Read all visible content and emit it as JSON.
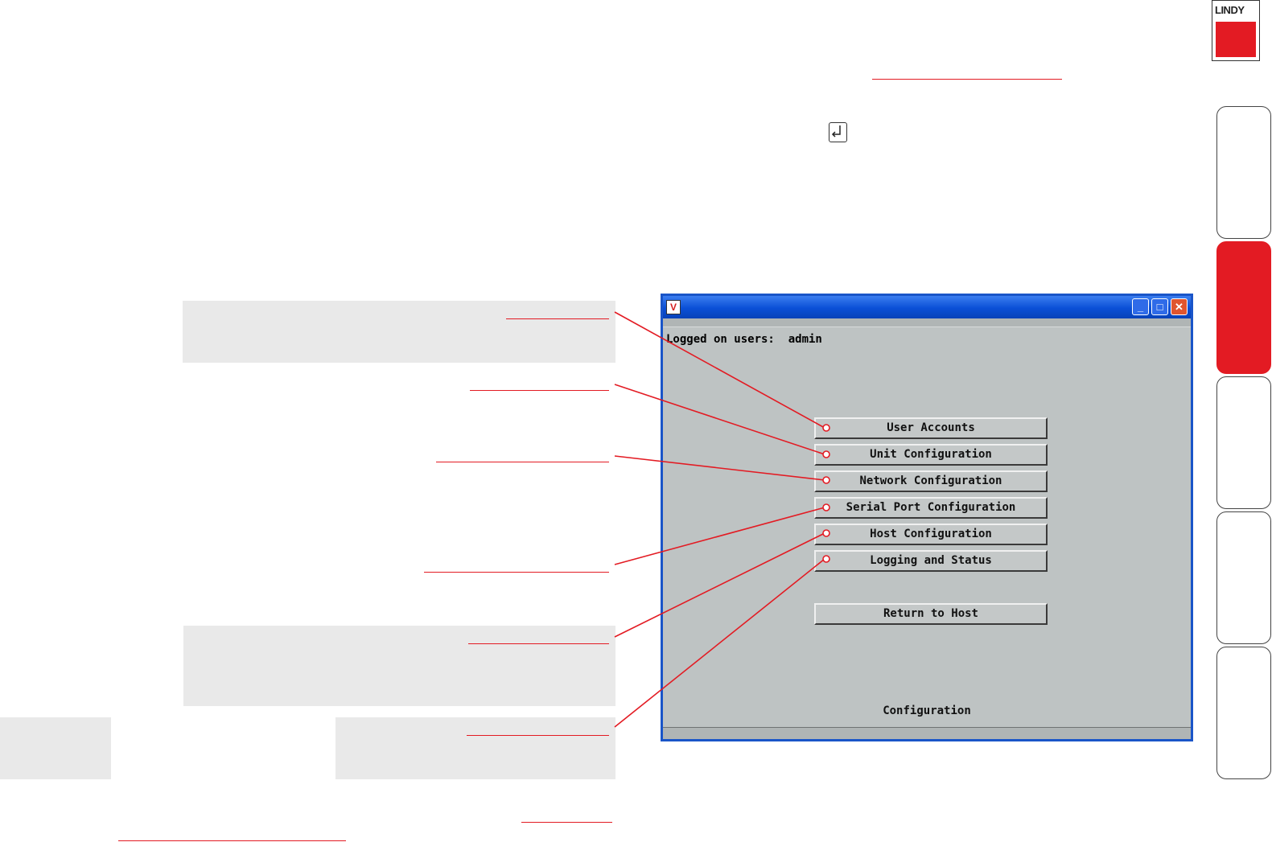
{
  "brand": {
    "logo_text": "LINDY"
  },
  "window": {
    "app_icon": "V",
    "logged_on_label": "Logged on users:",
    "logged_on_user": "admin",
    "buttons": [
      "User Accounts",
      "Unit Configuration",
      "Network Configuration",
      "Serial Port Configuration",
      "Host Configuration",
      "Logging and Status",
      "Return to Host"
    ],
    "status_text": "Configuration"
  },
  "icons": {
    "minimize": "minimize-icon",
    "maximize": "maximize-icon",
    "close": "close-icon",
    "enter": "enter-key-icon"
  },
  "colors": {
    "accent_red": "#e31b23",
    "window_bg": "#bec3c3",
    "titlebar_blue": "#0a4fd6"
  }
}
